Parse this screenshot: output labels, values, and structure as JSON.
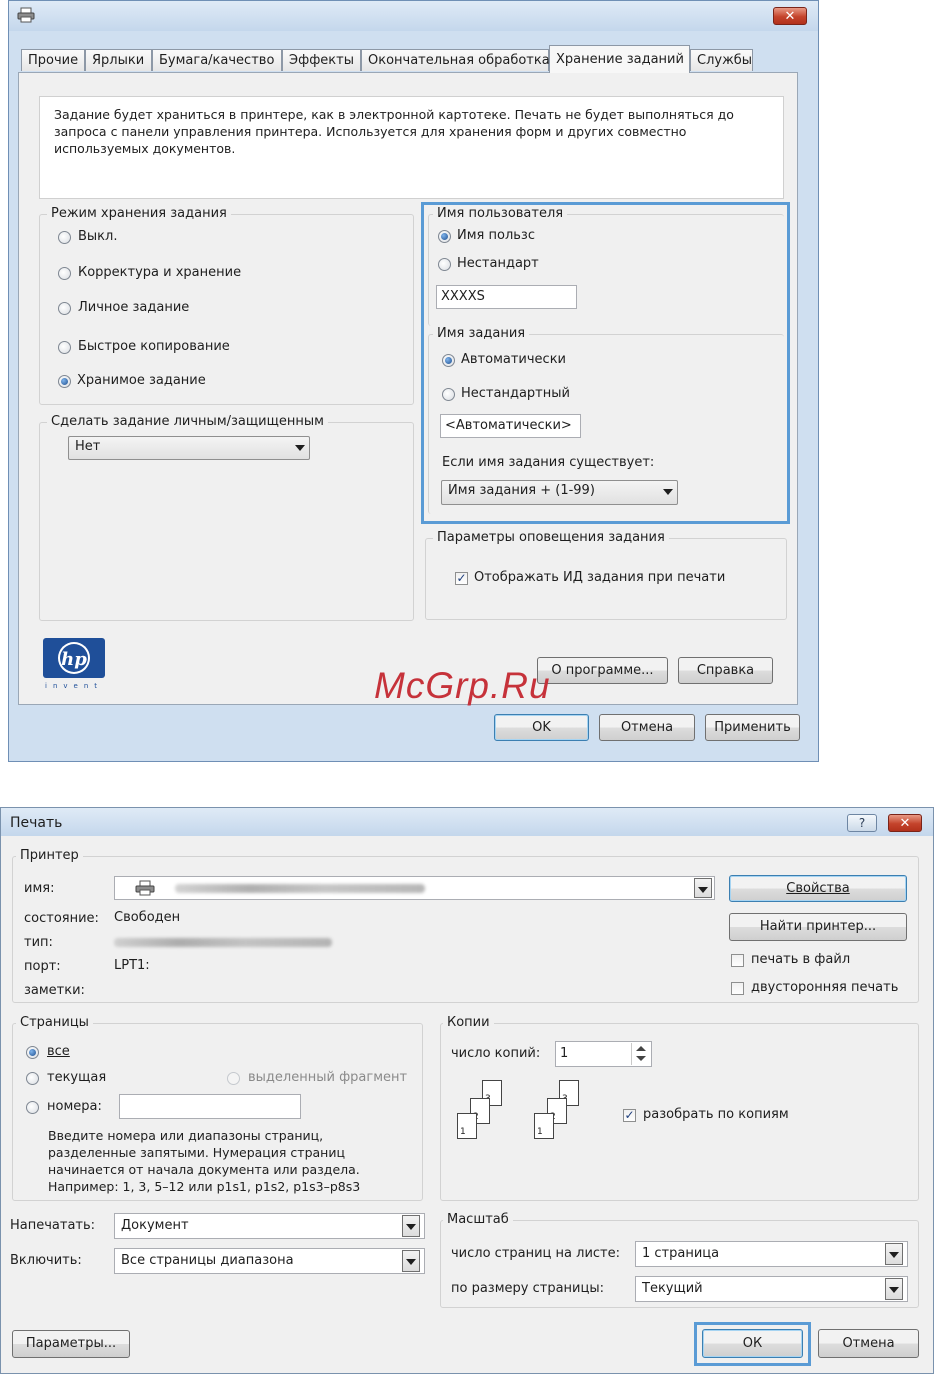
{
  "properties_dialog": {
    "tabs": [
      "Прочие",
      "Ярлыки",
      "Бумага/качество",
      "Эффекты",
      "Окончательная обработка",
      "Хранение заданий",
      "Службы"
    ],
    "active_tab": "Хранение заданий",
    "description": "Задание будет храниться в принтере, как в электронной картотеке. Печать не будет выполняться до запроса с панели управления принтера. Используется для хранения форм и других совместно используемых документов.",
    "storage_mode": {
      "label": "Режим хранения задания",
      "options": [
        "Выкл.",
        "Корректура и хранение",
        "Личное задание",
        "Быстрое копирование",
        "Хранимое задание"
      ],
      "selected": "Хранимое задание"
    },
    "private": {
      "label": "Сделать задание личным/защищенным",
      "value": "Нет"
    },
    "user_name": {
      "label": "Имя пользователя",
      "options": [
        "Имя пользс",
        "Нестандарт"
      ],
      "selected": "Имя пользс",
      "value": "XXXXS"
    },
    "job_name": {
      "label": "Имя задания",
      "options": [
        "Автоматически",
        "Нестандартный"
      ],
      "selected": "Автоматически",
      "value": "<Автоматически>",
      "exists_label": "Если имя задания существует:",
      "exists_value": "Имя задания + (1-99)"
    },
    "notification": {
      "label": "Параметры оповещения задания",
      "checkbox": "Отображать ИД задания при печати",
      "checked": true
    },
    "logo_text": "invent",
    "about_button": "О программе...",
    "help_button": "Справка",
    "ok_button": "OK",
    "cancel_button": "Отмена",
    "apply_button": "Применить",
    "close_glyph": "✕"
  },
  "watermark": "McGrp.Ru",
  "print_dialog": {
    "title": "Печать",
    "help_glyph": "?",
    "close_glyph": "✕",
    "printer": {
      "group_label": "Принтер",
      "name_label": "имя:",
      "status_label": "состояние:",
      "status_value": "Свободен",
      "type_label": "тип:",
      "port_label": "порт:",
      "port_value": "LPT1:",
      "notes_label": "заметки:",
      "properties_button": "Свойства",
      "find_button": "Найти принтер...",
      "print_to_file": "печать в файл",
      "duplex": "двусторонняя печать"
    },
    "pages": {
      "group_label": "Страницы",
      "all": "все",
      "current": "текущая",
      "selection": "выделенный фрагмент",
      "numbers": "номера:",
      "hint": [
        "Введите номера или диапазоны страниц,",
        "разделенные запятыми. Нумерация страниц",
        "начинается от начала документа или раздела.",
        "Например: 1, 3, 5–12 или p1s1, p1s2, p1s3–p8s3"
      ]
    },
    "copies": {
      "group_label": "Копии",
      "count_label": "число копий:",
      "count_value": "1",
      "collate": "разобрать по копиям",
      "collate_checked": true,
      "page_numbers": [
        "3",
        "2",
        "1"
      ]
    },
    "print_what_label": "Напечатать:",
    "print_what_value": "Документ",
    "include_label": "Включить:",
    "include_value": "Все страницы диапазона",
    "zoom": {
      "group_label": "Масштаб",
      "pages_per_sheet_label": "число страниц на листе:",
      "pages_per_sheet_value": "1 страница",
      "scale_label": "по размеру страницы:",
      "scale_value": "Текущий"
    },
    "options_button": "Параметры...",
    "ok_button": "ОК",
    "cancel_button": "Отмена"
  },
  "colors": {
    "highlight": "#5a9bd5",
    "watermark": "#c6323a",
    "window_frame": "#cfdff0"
  }
}
